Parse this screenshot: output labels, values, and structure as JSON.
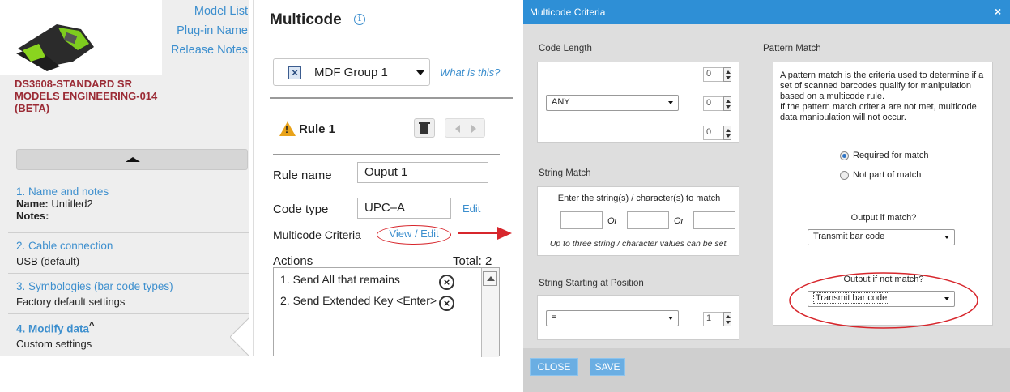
{
  "left": {
    "links": [
      "Model List",
      "Plug-in Name",
      "Release Notes"
    ],
    "device_name": "DS3608-STANDARD SR MODELS ENGINEERING-014 (BETA)",
    "steps": [
      {
        "title": "1. Name and notes",
        "name_label": "Name:",
        "name_value": "Untitled2",
        "notes_label": "Notes:"
      },
      {
        "title": "2. Cable connection",
        "value": "USB (default)"
      },
      {
        "title": "3. Symbologies (bar code types)",
        "value": "Factory default settings"
      },
      {
        "title": "4. Modify data",
        "suffix": "^",
        "value": "Custom settings"
      }
    ]
  },
  "middle": {
    "title": "Multicode",
    "group_select": "MDF Group 1",
    "what_is_this": "What is this?",
    "rule_label": "Rule 1",
    "rule_name_label": "Rule name",
    "rule_name_value": "Ouput 1",
    "code_type_label": "Code type",
    "code_type_value": "UPC–A",
    "edit_link": "Edit",
    "multicode_criteria_label": "Multicode Criteria",
    "view_edit_link": "View / Edit",
    "actions_label": "Actions",
    "total_label": "Total: 2",
    "actions": [
      "1. Send All that remains",
      "2. Send Extended Key <Enter>"
    ]
  },
  "dialog": {
    "title": "Multicode Criteria",
    "code_length": {
      "label": "Code Length",
      "select_value": "ANY",
      "spinners": [
        "0",
        "0",
        "0"
      ]
    },
    "string_match": {
      "label": "String Match",
      "instruction": "Enter the string(s) / character(s) to match",
      "or_label": "Or",
      "note": "Up to three string / character values can be set."
    },
    "string_starting": {
      "label": "String Starting at Position",
      "select_value": "=",
      "spinner": "1"
    },
    "pattern_match": {
      "label": "Pattern Match",
      "description": "A pattern match is the criteria used to determine if a set of scanned barcodes qualify for manipulation based on a multicode rule.",
      "description2": "If the pattern match criteria are not met, multicode data manipulation will not occur.",
      "radio_required": "Required for match",
      "radio_not_part": "Not part of match",
      "output_if_match_label": "Output if match?",
      "output_if_match_value": "Transmit bar code",
      "output_if_not_match_label": "Output if not match?",
      "output_if_not_match_value": "Transmit bar code"
    },
    "buttons": {
      "close": "CLOSE",
      "save": "SAVE"
    }
  },
  "colors": {
    "accent": "#2e8fd6",
    "link": "#3d8fce",
    "device_name": "#9b2b35",
    "annotation": "#d7262c"
  }
}
